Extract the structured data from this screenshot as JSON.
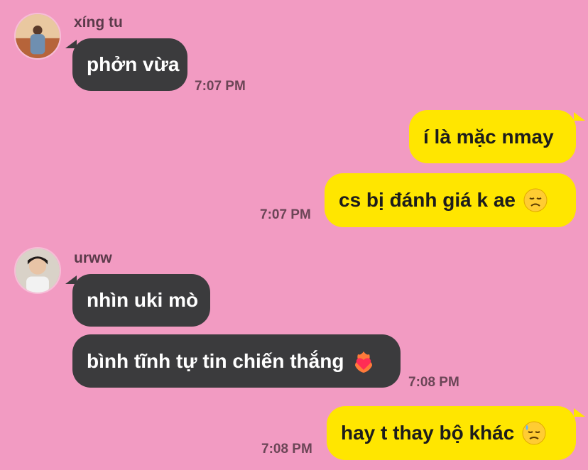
{
  "chat": {
    "messages": [
      {
        "sender": "xíng tu",
        "text": "phởn vừa",
        "time": "7:07 PM"
      },
      {
        "text": "í là mặc nmay"
      },
      {
        "text": "cs bị đánh giá k ae",
        "time": "7:07 PM",
        "emoji": "disappointed-face-icon"
      },
      {
        "sender": "urww",
        "text": "nhìn uki mò"
      },
      {
        "text": "bình tĩnh tự tin chiến thắng",
        "time": "7:08 PM",
        "emoji": "heart-on-fire-icon"
      },
      {
        "text": "hay t thay bộ khác",
        "time": "7:08 PM",
        "emoji": "downcast-face-with-sweat-icon"
      }
    ]
  },
  "colors": {
    "background": "#f29bc2",
    "incoming_bubble": "#3b3b3d",
    "outgoing_bubble": "#ffe600"
  }
}
